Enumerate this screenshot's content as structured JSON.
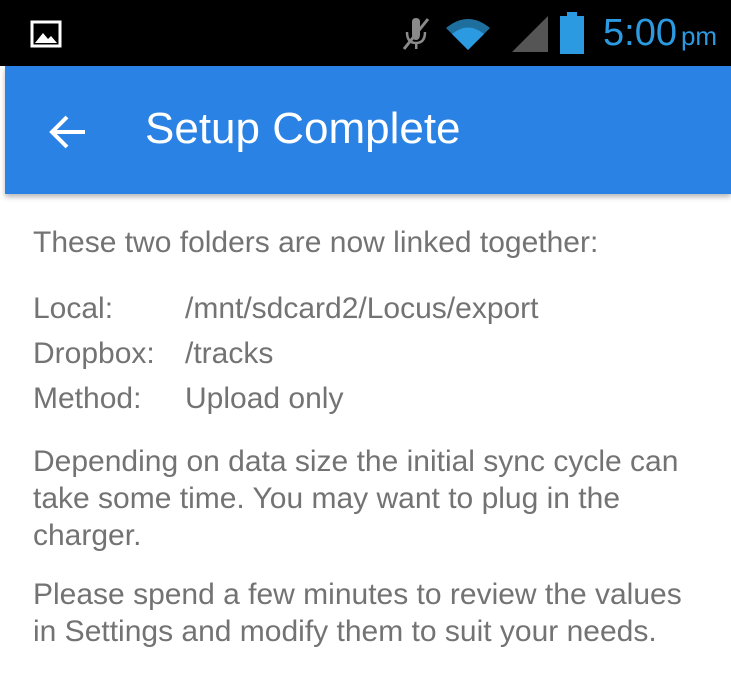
{
  "status_bar": {
    "time": "5:00",
    "ampm": "pm",
    "icons": [
      "image-notification-icon",
      "mute-icon",
      "wifi-icon",
      "signal-icon",
      "battery-icon"
    ],
    "time_color": "#2c9ae0"
  },
  "app_bar": {
    "title": "Setup Complete",
    "back_icon": "arrow-back-icon",
    "color": "#2a82e4"
  },
  "content": {
    "intro": "These two folders are now linked together:",
    "details": [
      {
        "label": "Local:",
        "value": "/mnt/sdcard2/Locus/export"
      },
      {
        "label": "Dropbox:",
        "value": "/tracks"
      },
      {
        "label": "Method:",
        "value": "Upload only"
      }
    ],
    "sync_note": "Depending on data size the initial sync cycle can take some time. You may want to plug in the charger.",
    "review_note": "Please spend a few minutes to review the values in Settings and modify them to suit your needs.",
    "text_color": "#737373"
  }
}
